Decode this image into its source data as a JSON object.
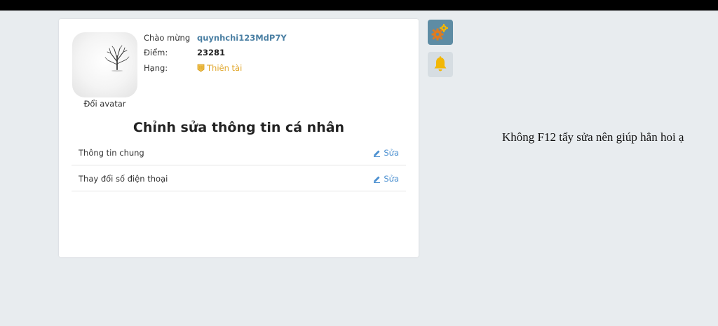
{
  "profile": {
    "avatar_alt": "tree-in-snow",
    "change_avatar_label": "Đổi avatar",
    "greeting_label": "Chào mừng",
    "username": "quynhchi123MdP7Y",
    "score_label": "Điểm:",
    "score_value": "23281",
    "rank_label": "Hạng:",
    "rank_value": "Thiên tài"
  },
  "edit_section": {
    "title": "Chỉnh sửa thông tin cá nhân",
    "rows": [
      {
        "label": "Thông tin chung",
        "action": "Sửa"
      },
      {
        "label": "Thay đổi số điện thoại",
        "action": "Sửa"
      }
    ]
  },
  "side_buttons": {
    "settings_icon": "gears-icon",
    "notification_icon": "bell-icon"
  },
  "caption": "Không F12 tẩy sửa nên giúp hẳn hoi ạ",
  "colors": {
    "background": "#e8ecef",
    "username": "#4a7fa3",
    "rank": "#e0a528",
    "edit_link": "#4a8fd0",
    "settings_button": "#5e8ca4",
    "bell": "#f2b705"
  }
}
